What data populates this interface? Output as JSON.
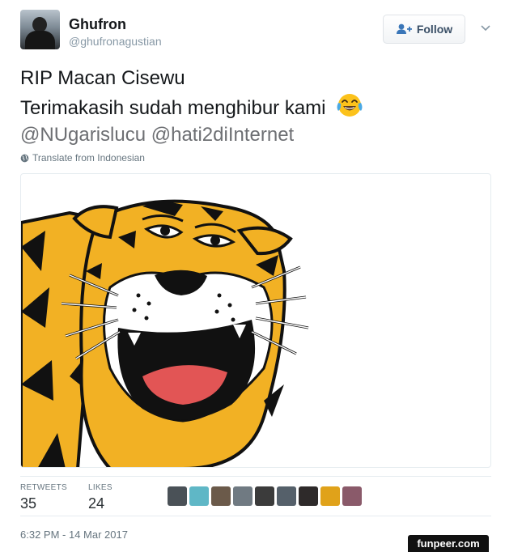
{
  "user": {
    "display_name": "Ghufron",
    "screen_name": "@ghufronagustian"
  },
  "follow_button": {
    "label": "Follow"
  },
  "tweet": {
    "line1": "RIP Macan Cisewu",
    "line2": "Terimakasih sudah menghibur kami",
    "mention1": "@NUgarislucu",
    "mention2": "@hati2diInternet",
    "emoji": "face-with-tears-of-joy-icon"
  },
  "translate": {
    "label": "Translate from Indonesian"
  },
  "stats": {
    "retweets_label": "RETWEETS",
    "retweets_count": "35",
    "likes_label": "LIKES",
    "likes_count": "24"
  },
  "likers": [
    {
      "color": "#4a5157"
    },
    {
      "color": "#5fb7c6"
    },
    {
      "color": "#6b5a4a"
    },
    {
      "color": "#707a82"
    },
    {
      "color": "#3b3b3b"
    },
    {
      "color": "#55606a"
    },
    {
      "color": "#2e2a2a"
    },
    {
      "color": "#e0a21a"
    },
    {
      "color": "#8a5a6a"
    }
  ],
  "timestamp": "6:32 PM - 14 Mar 2017",
  "watermark": "funpeer.com",
  "colors": {
    "tiger_orange": "#f2b124",
    "link_gray": "#6d6f73",
    "meta_gray": "#66757f"
  }
}
